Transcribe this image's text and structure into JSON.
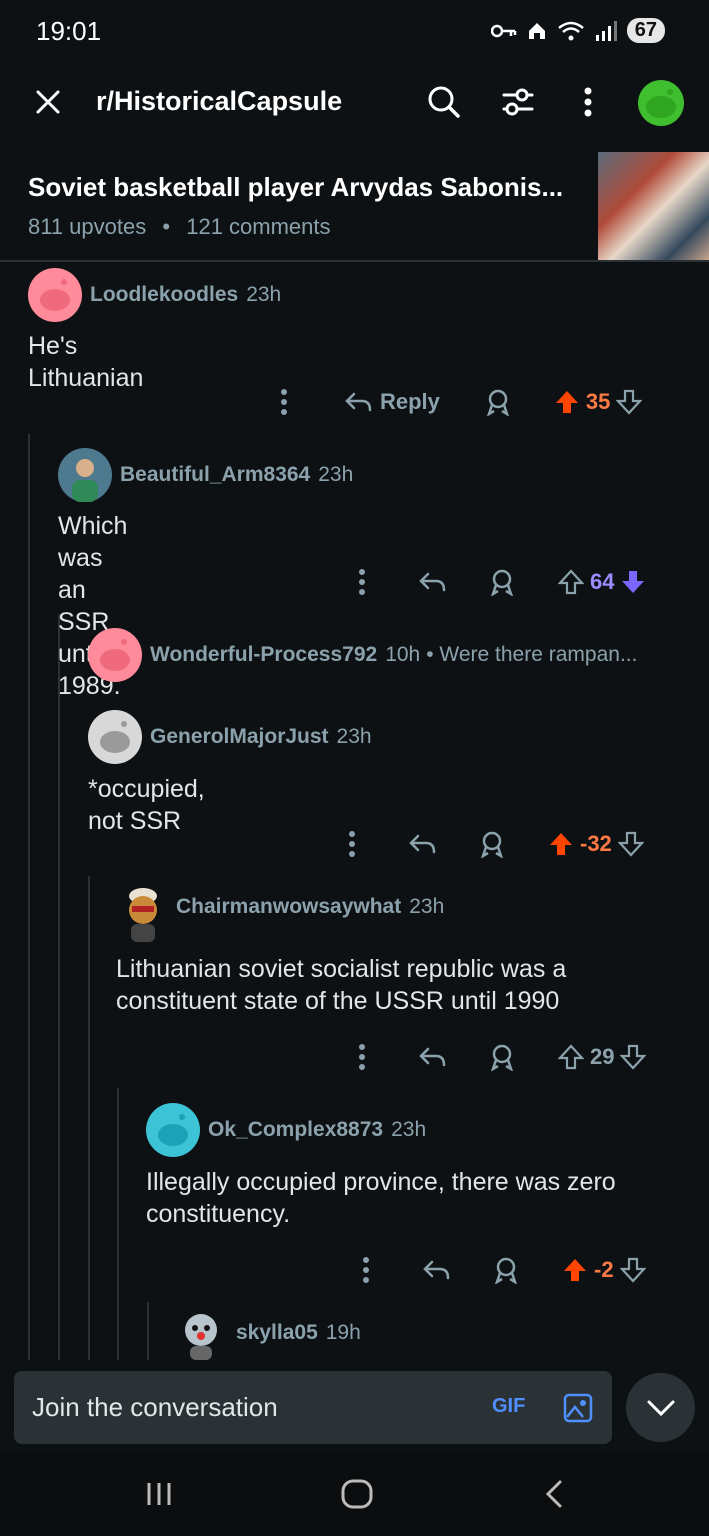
{
  "status": {
    "time": "19:01",
    "battery": "67"
  },
  "header": {
    "subreddit": "r/HistoricalCapsule"
  },
  "post": {
    "title": "Soviet basketball player Arvydas Sabonis...",
    "upvotes": "811 upvotes",
    "separator": "•",
    "comments": "121 comments"
  },
  "comments": [
    {
      "author": "Loodlekoodles",
      "time": "23h",
      "body": "He's Lithuanian",
      "reply_label": "Reply",
      "votes": "35",
      "vote_state": "up"
    },
    {
      "author": "Beautiful_Arm8364",
      "time": "23h",
      "body": "Which was an SSR until 1989.",
      "votes": "64",
      "vote_state": "down"
    },
    {
      "author": "Wonderful-Process792",
      "time": "10h",
      "preview": "• Were there rampan..."
    },
    {
      "author": "GenerolMajorJust",
      "time": "23h",
      "body": "*occupied, not SSR",
      "votes": "-32",
      "vote_state": "up"
    },
    {
      "author": "Chairmanwowsaywhat",
      "time": "23h",
      "body": "Lithuanian soviet socialist republic was a constituent state of the USSR until 1990",
      "votes": "29",
      "vote_state": "none"
    },
    {
      "author": "Ok_Complex8873",
      "time": "23h",
      "body": "Illegally occupied province, there was zero constituency.",
      "votes": "-2",
      "vote_state": "up"
    },
    {
      "author": "skylla05",
      "time": "19h"
    }
  ],
  "composer": {
    "placeholder": "Join the conversation",
    "gif_label": "GIF"
  },
  "colors": {
    "upvote": "#ff4500",
    "downvote": "#7a67ff",
    "background": "#0e1113",
    "meta": "#8ba2ad"
  }
}
